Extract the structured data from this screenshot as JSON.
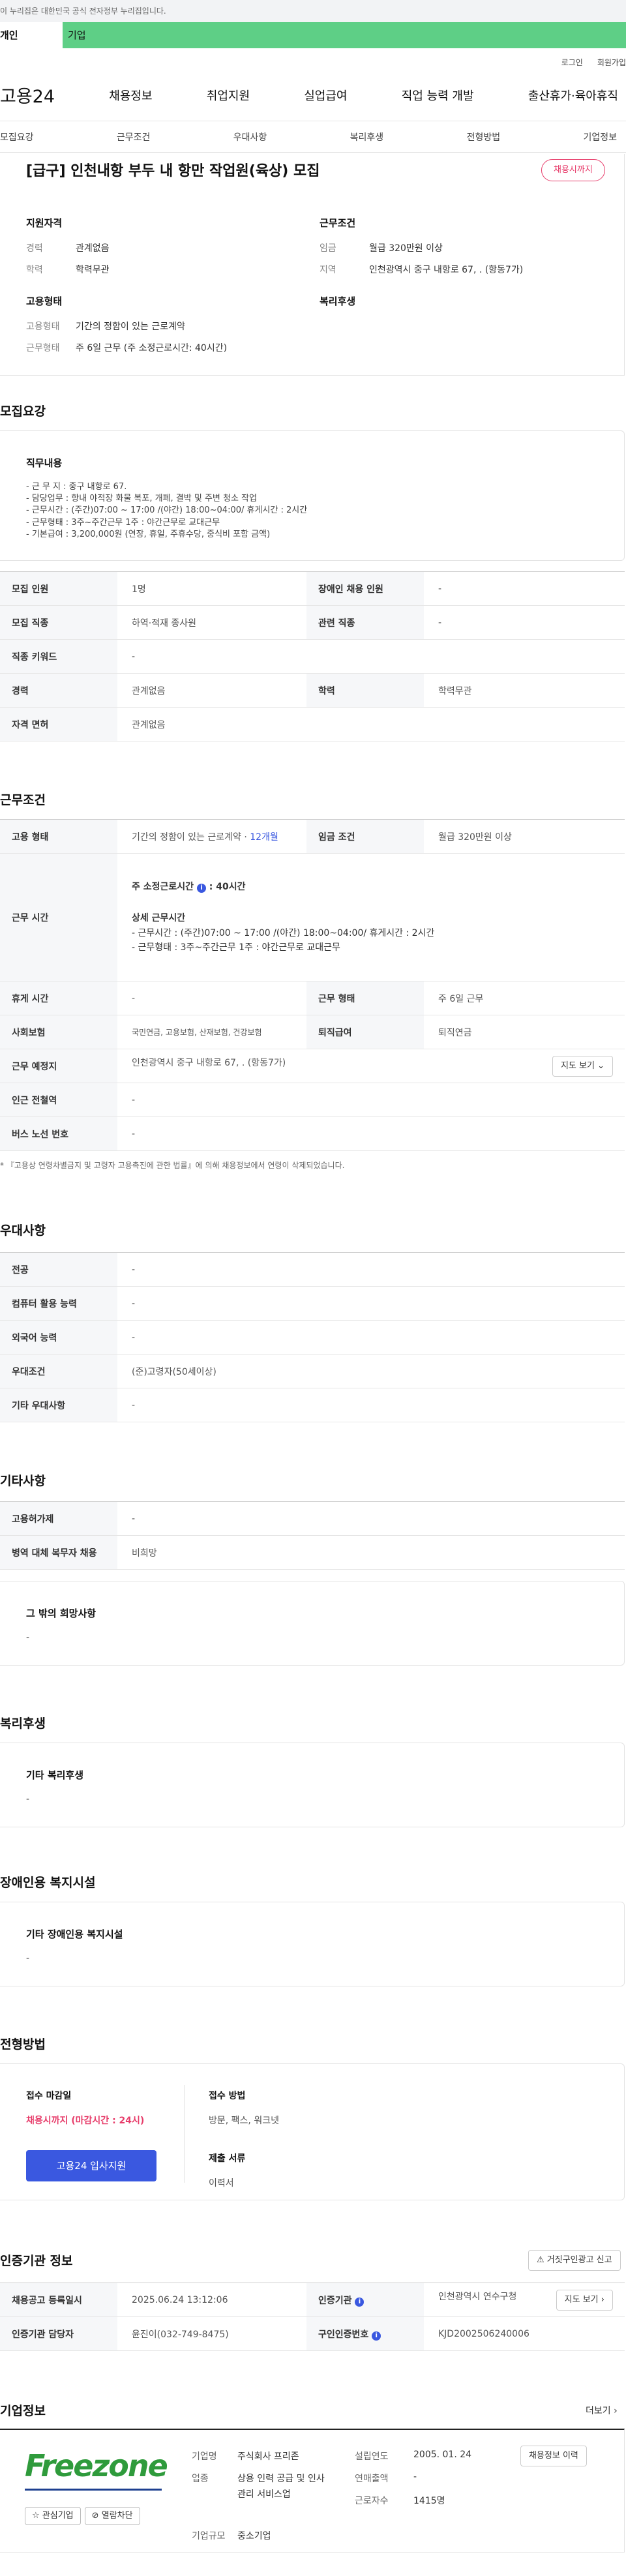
{
  "gov_bar": "이 누리집은 대한민국 공식 전자정부 누리집입니다.",
  "tabs": [
    "개인",
    "기업"
  ],
  "util": [
    "로그인",
    "회원가입"
  ],
  "logo": "고용24",
  "gnb": [
    "채용정보",
    "취업지원",
    "실업급여",
    "직업 능력 개발",
    "출산휴가·육아휴직"
  ],
  "snb": [
    "모집요강",
    "근무조건",
    "우대사항",
    "복리후생",
    "전형방법",
    "기업정보"
  ],
  "summary": {
    "title": "[급구] 인천내항 부두 내 항만 작업원(육상) 모집",
    "badge": "채용시까지",
    "qual_title": "지원자격",
    "qual": [
      {
        "k": "경력",
        "v": "관계없음"
      },
      {
        "k": "학력",
        "v": "학력무관"
      }
    ],
    "emp_title": "고용형태",
    "emp": [
      {
        "k": "고용형태",
        "v": "기간의 정함이 있는 근로계약"
      },
      {
        "k": "근무형태",
        "v": "주 6일 근무 (주 소정근로시간: 40시간)"
      }
    ],
    "cond_title": "근무조건",
    "cond": [
      {
        "k": "임금",
        "v": "월급 320만원 이상"
      },
      {
        "k": "지역",
        "v": "인천광역시 중구 내항로 67, . (항동7가)"
      }
    ],
    "welfare_title": "복리후생"
  },
  "recruit": {
    "title": "모집요강",
    "duty_label": "직무내용",
    "duty_text": "- 근 무 지 : 중구 내항로 67.\n- 담당업무 : 항내 야적장 화물 복포, 개폐, 결박 및 주변 청소 작업\n- 근무시간 : (주간)07:00 ~ 17:00 /(야간) 18:00~04:00/ 휴게시간 : 2시간\n- 근무형태 : 3주~주간근무 1주 : 야간근무로 교대근무\n- 기본급여 : 3,200,000원 (연장, 휴일, 주휴수당, 중식비 포함 금액)",
    "rows": [
      [
        "모집 인원",
        "1명",
        "장애인 채용 인원",
        "-"
      ],
      [
        "모집 직종",
        "하역·적재 종사원",
        "관련 직종",
        "-"
      ],
      [
        "직종 키워드",
        "-"
      ],
      [
        "경력",
        "관계없음",
        "학력",
        "학력무관"
      ],
      [
        "자격 면허",
        "관계없음"
      ]
    ]
  },
  "work": {
    "title": "근무조건",
    "emp_label": "고용 형태",
    "emp_value": "기간의 정함이 있는 근로계약 · ",
    "emp_period": "12개월",
    "wage_label": "임금 조건",
    "wage_value": "월급 320만원 이상",
    "time_label": "근무 시간",
    "weekly_hours_label": "주 소정근로시간",
    "weekly_hours_value": "40시간",
    "detail_label": "상세 근무시간",
    "detail_lines": [
      "- 근무시간 : (주간)07:00 ~ 17:00 /(야간) 18:00~04:00/ 휴게시간 : 2시간",
      "- 근무형태 : 3주~주간근무 1주 : 야간근무로 교대근무"
    ],
    "rows": [
      [
        "휴게 시간",
        "-",
        "근무 형태",
        "주 6일 근무"
      ],
      [
        "사회보험",
        "국민연금, 고용보험, 산재보험, 건강보험",
        "퇴직급여",
        "퇴직연금"
      ]
    ],
    "addr_label": "근무 예정지",
    "addr_value": "인천광역시 중구 내항로 67, . (항동7가)",
    "map_btn": "지도 보기",
    "subway_label": "인근 전철역",
    "subway_value": "-",
    "bus_label": "버스 노선 번호",
    "bus_value": "-",
    "note": "* 『고용상 연령차별금지 및 고령자 고용촉진에 관한 법률』에 의해 채용정보에서 연령이 삭제되었습니다."
  },
  "pref": {
    "title": "우대사항",
    "rows": [
      [
        "전공",
        "-"
      ],
      [
        "컴퓨터 활용 능력",
        "-"
      ],
      [
        "외국어 능력",
        "-"
      ],
      [
        "우대조건",
        "(준)고령자(50세이상)"
      ],
      [
        "기타 우대사항",
        "-"
      ]
    ]
  },
  "etc": {
    "title": "기타사항",
    "rows": [
      [
        "고용허가제",
        "-"
      ],
      [
        "병역 대체 복무자 채용",
        "비희망"
      ]
    ],
    "box_title": "그 밖의 희망사항",
    "box_value": "-"
  },
  "welfare": {
    "title": "복리후생",
    "box_title": "기타 복리후생",
    "box_value": "-"
  },
  "disabled": {
    "title": "장애인용 복지시설",
    "box_title": "기타 장애인용 복지시설",
    "box_value": "-"
  },
  "selection": {
    "title": "전형방법",
    "deadline_label": "접수 마감일",
    "deadline_value": "채용시까지 (마감시간 : 24시)",
    "apply_btn": "고용24 입사지원",
    "method_label": "접수 방법",
    "method_value": "방문, 팩스, 워크넷",
    "docs_label": "제출 서류",
    "docs_value": "이력서"
  },
  "cert": {
    "title": "인증기관 정보",
    "report_btn": "거짓구인광고 신고",
    "r1": [
      "채용공고 등록일시",
      "2025.06.24 13:12:06",
      "인증기관",
      "인천광역시 연수구청"
    ],
    "r2": [
      "인증기관 담당자",
      "윤진이(032-749-8475)",
      "구인인증번호",
      "KJD2002506240006"
    ],
    "map_btn": "지도 보기"
  },
  "company": {
    "title": "기업정보",
    "more": "더보기",
    "logo_text": "Freezone",
    "fav_btn": "관심기업",
    "block_btn": "열람차단",
    "history_btn": "채용정보 이력",
    "fields": [
      [
        "기업명",
        "주식회사 프리존",
        "설립연도",
        "2005. 01. 24"
      ],
      [
        "업종",
        "상용 인력 공급 및 인사관리 서비스업",
        "연매출액",
        "-"
      ],
      [
        "",
        "",
        "근로자수",
        "1415명"
      ],
      [
        "기업규모",
        "중소기업",
        "",
        ""
      ]
    ],
    "brand_green": "#2f9b3c",
    "brand_blue": "#1d3f8f"
  },
  "colors": {
    "accent": "#3a58e0",
    "alert": "#e73c6a",
    "green_tab": "#5ecf86"
  }
}
